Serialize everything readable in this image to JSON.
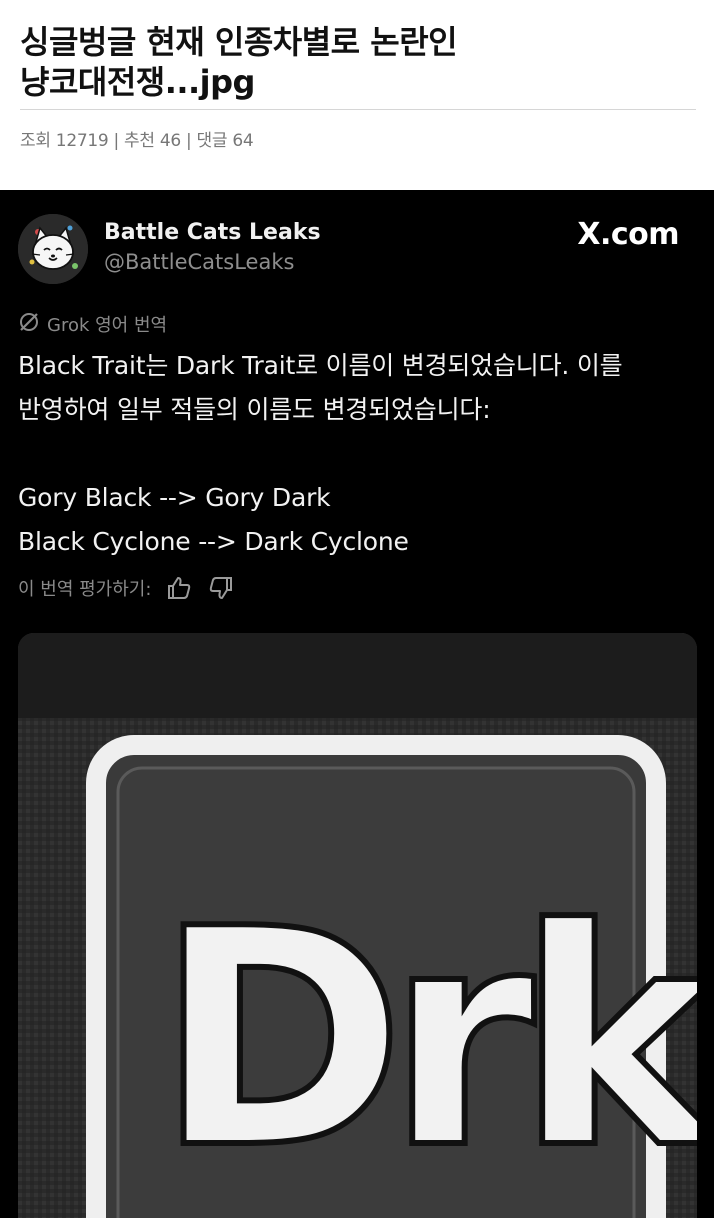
{
  "post": {
    "title_line1": "싱글벙글 현재 인종차별로 논란인",
    "title_line2": "냥코대전쟁...jpg",
    "views_label": "조회",
    "views": "12719",
    "recommend_label": "추천",
    "recommend": "46",
    "comments_label": "댓글",
    "comments": "64",
    "separator": "|"
  },
  "tweet": {
    "display_name": "Battle Cats Leaks",
    "handle": "@BattleCatsLeaks",
    "source": "X.com",
    "translation_label": "Grok 영어 번역",
    "text_lines": [
      "Black Trait는 Dark Trait로 이름이 변경되었습니다. 이를",
      "반영하여 일부 적들의 이름도 변경되었습니다:",
      "Gory Black --> Gory Dark",
      "Black Cyclone --> Dark Cyclone"
    ],
    "rate_label": "이 번역 평가하기:",
    "media_text": "Drk"
  },
  "icons": {
    "grok": "grok-icon",
    "thumbs_up": "thumbs-up-icon",
    "thumbs_down": "thumbs-down-icon",
    "avatar": "cat-avatar"
  },
  "colors": {
    "card_bg": "#000000",
    "muted": "#8a8a8a",
    "title": "#111111"
  }
}
